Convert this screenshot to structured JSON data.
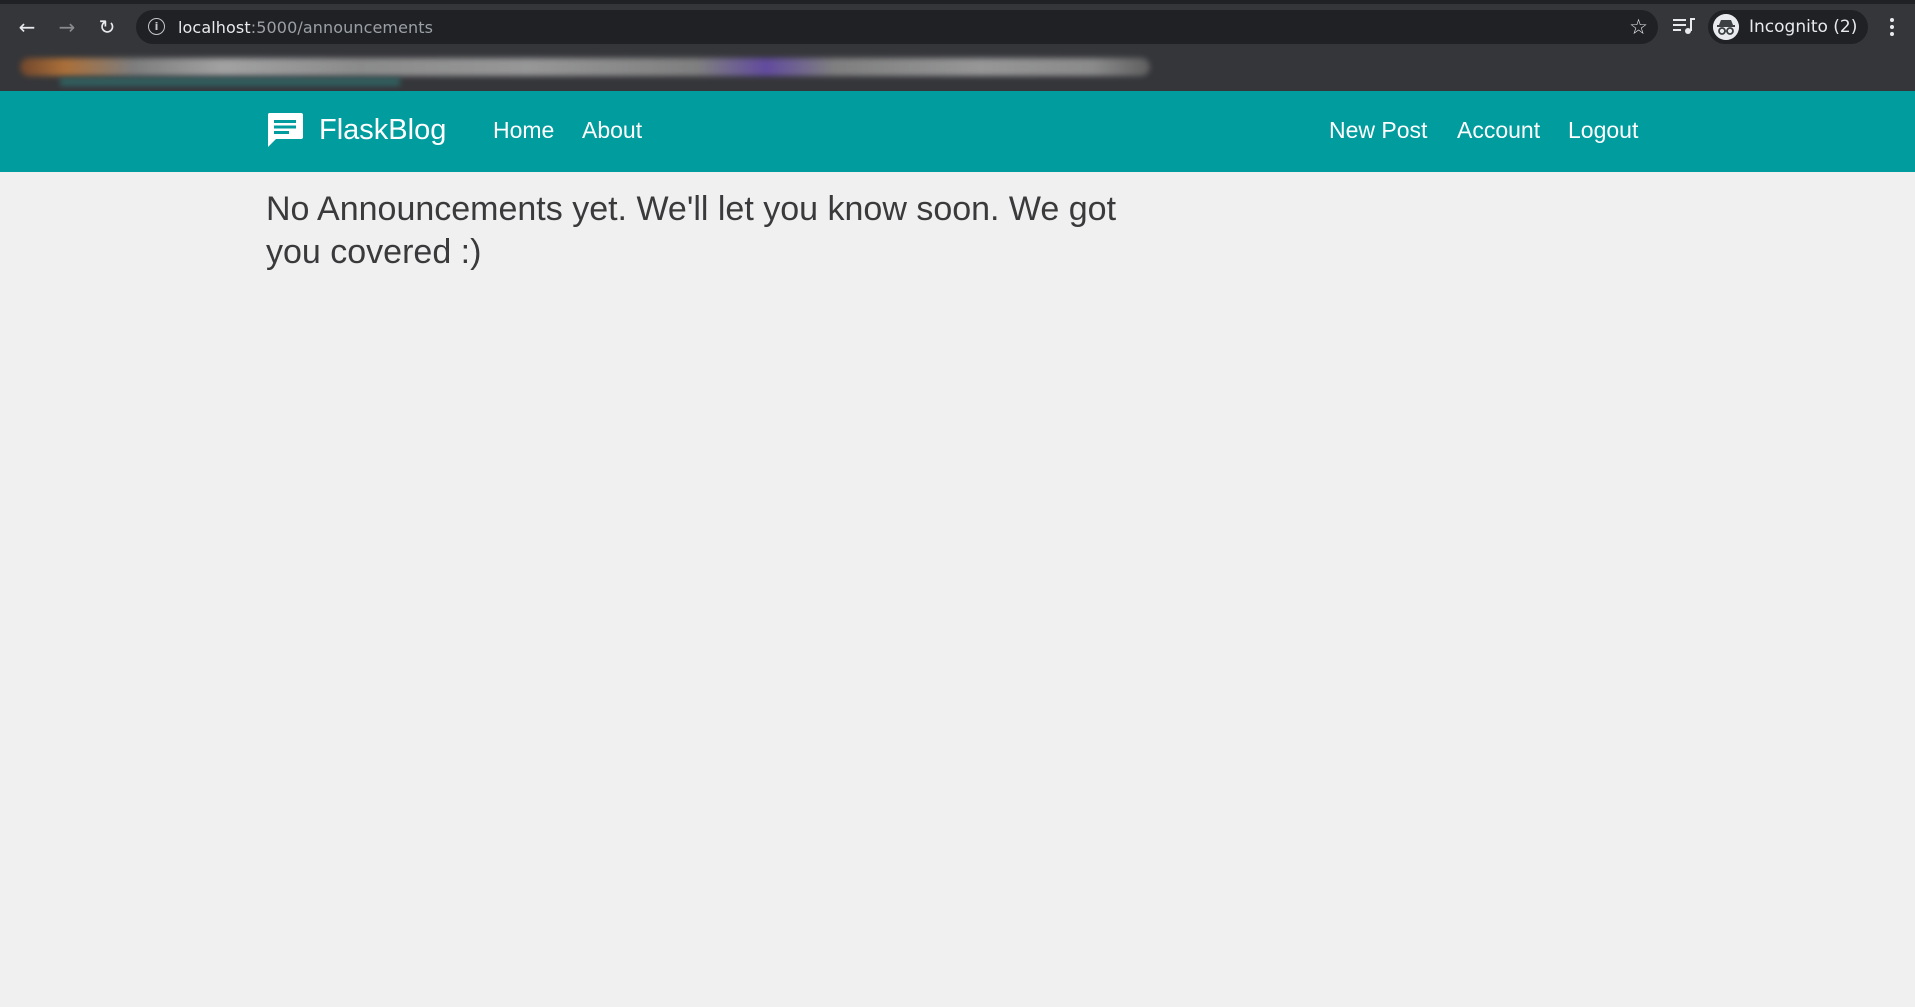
{
  "browser": {
    "url_host": "localhost",
    "url_path": ":5000/announcements",
    "profile_label": "Incognito (2)",
    "back_glyph": "←",
    "forward_glyph": "→",
    "reload_glyph": "↻",
    "info_glyph": "i",
    "star_glyph": "☆",
    "icons": [
      "back-icon",
      "forward-icon",
      "reload-icon",
      "info-icon",
      "star-icon",
      "media-queue-icon",
      "incognito-icon",
      "menu-icon"
    ]
  },
  "site": {
    "brand": "FlaskBlog",
    "nav_left": [
      "Home",
      "About"
    ],
    "nav_right": [
      "New Post",
      "Account",
      "Logout"
    ],
    "accent_color": "#009c9e"
  },
  "main": {
    "message": "No Announcements yet. We'll let you know soon. We got you covered :)"
  }
}
